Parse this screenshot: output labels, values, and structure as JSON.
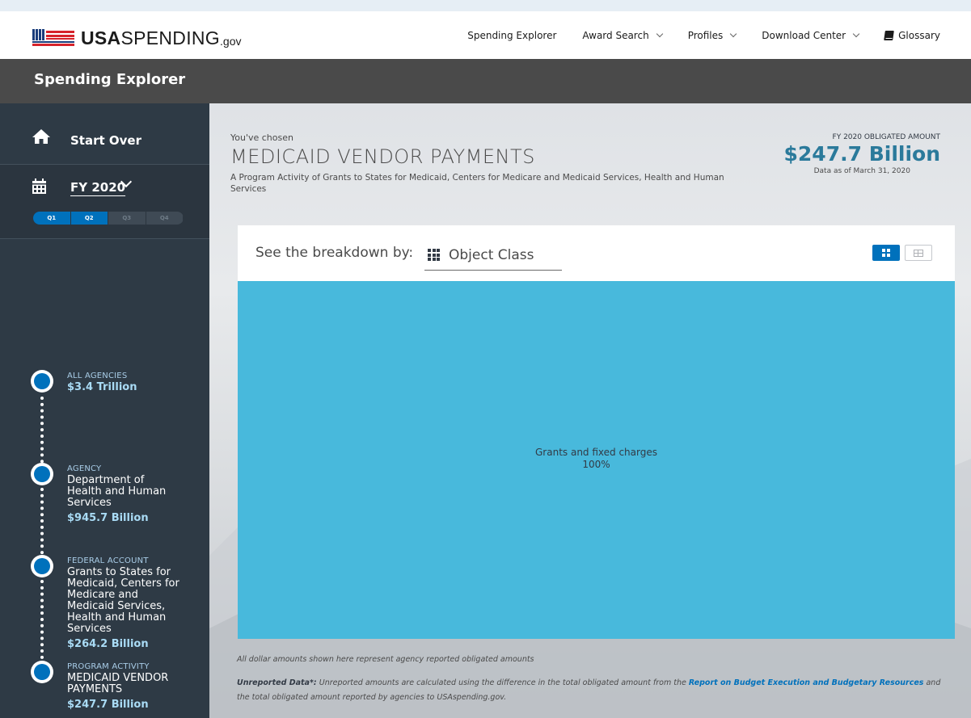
{
  "brand": {
    "logo_bold": "USA",
    "logo_rest": "SPENDING",
    "logo_suffix": ".gov"
  },
  "nav": {
    "items": [
      {
        "label": "Spending Explorer",
        "dropdown": false
      },
      {
        "label": "Award Search",
        "dropdown": true
      },
      {
        "label": "Profiles",
        "dropdown": true
      },
      {
        "label": "Download Center",
        "dropdown": true
      },
      {
        "label": "Glossary",
        "icon": "book-icon"
      }
    ]
  },
  "page_title": "Spending Explorer",
  "sidebar": {
    "start_over": "Start Over",
    "fiscal_year": "FY 2020",
    "quarters": [
      {
        "label": "Q1",
        "active": true
      },
      {
        "label": "Q2",
        "active": true
      },
      {
        "label": "Q3",
        "active": false
      },
      {
        "label": "Q4",
        "active": false
      }
    ],
    "tree": [
      {
        "type": "All Agencies",
        "name": "",
        "amount": "$3.4 Trillion"
      },
      {
        "type": "Agency",
        "name": "Department of Health and Human Services",
        "amount": "$945.7 Billion"
      },
      {
        "type": "Federal Account",
        "name": "Grants to States for Medicaid, Centers for Medicare and Medicaid Services, Health and Human Services",
        "amount": "$264.2 Billion"
      },
      {
        "type": "Program Activity",
        "name": "MEDICAID VENDOR PAYMENTS",
        "amount": "$247.7 Billion"
      }
    ]
  },
  "main": {
    "chosen_label": "You've chosen",
    "title": "MEDICAID VENDOR PAYMENTS",
    "description": "A Program Activity of Grants to States for Medicaid, Centers for Medicare and Medicaid Services, Health and Human Services",
    "obligated_label": "FY 2020 OBLIGATED AMOUNT",
    "obligated_value": "$247.7 Billion",
    "data_as_of": "Data as of March 31, 2020",
    "breakdown_label": "See the breakdown by:",
    "breakdown_value": "Object Class",
    "treemap": [
      {
        "label": "Grants and fixed charges",
        "percent": "100%",
        "share": 1.0,
        "color": "#48b9dc"
      }
    ],
    "footnote1": "All dollar amounts shown here represent agency reported obligated amounts",
    "footnote2_bold": "Unreported Data*:",
    "footnote2_a": " Unreported amounts are calculated using the difference in the total obligated amount from the ",
    "footnote2_link": "Report on Budget Execution and Budgetary Resources",
    "footnote2_b": " and the total obligated amount reported by agencies to USAspending.gov."
  },
  "colors": {
    "accent": "#0071bc",
    "sidebar": "#2e3a45",
    "title_bar": "#4a4a4a",
    "treemap": "#48b9dc",
    "amount": "#2b7a9b"
  }
}
